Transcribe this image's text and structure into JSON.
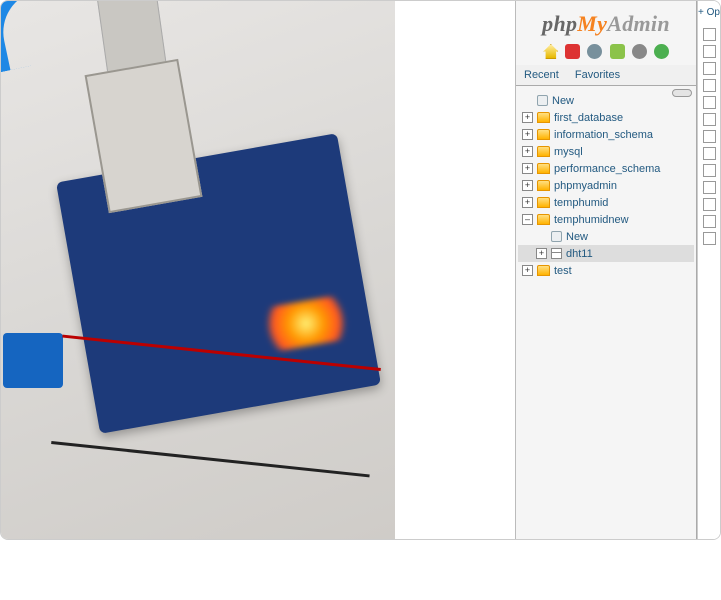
{
  "photo": {
    "description": "Arduino board with Ethernet shield, DHT11 sensor and lit status LEDs on a white surface"
  },
  "app": {
    "logo_php": "php",
    "logo_my": "My",
    "logo_admin": "Admin"
  },
  "toolbar": {
    "icons": [
      "home-icon",
      "sql-icon",
      "help-icon",
      "docs-icon",
      "settings-icon",
      "reload-icon"
    ]
  },
  "tabs": {
    "recent": "Recent",
    "favorites": "Favorites"
  },
  "tree": {
    "new_label": "New",
    "databases": [
      {
        "name": "first_database",
        "expanded": false
      },
      {
        "name": "information_schema",
        "expanded": false
      },
      {
        "name": "mysql",
        "expanded": false
      },
      {
        "name": "performance_schema",
        "expanded": false
      },
      {
        "name": "phpmyadmin",
        "expanded": false
      },
      {
        "name": "temphumid",
        "expanded": false
      },
      {
        "name": "temphumidnew",
        "expanded": true,
        "children": {
          "new_label": "New",
          "tables": [
            {
              "name": "dht11",
              "selected": true
            }
          ]
        }
      },
      {
        "name": "test",
        "expanded": false
      }
    ]
  },
  "rightstrip": {
    "options_label": "+ Op",
    "checkbox_count": 13
  }
}
